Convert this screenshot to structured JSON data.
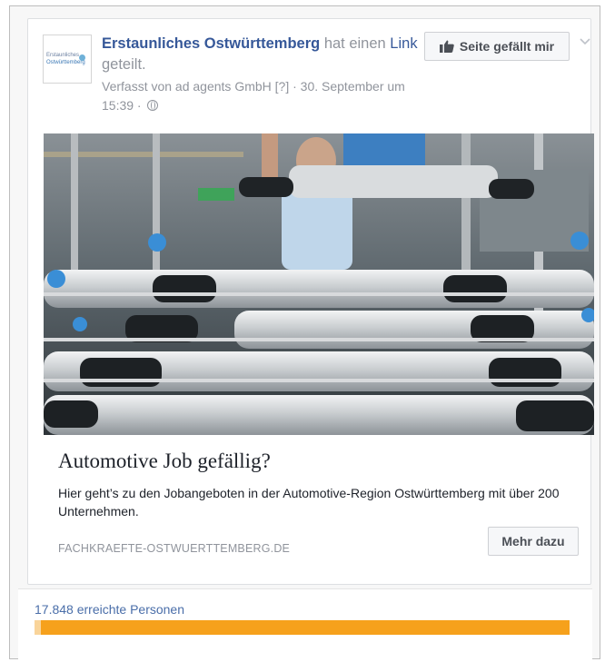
{
  "post": {
    "page_name": "Erstaunliches Ostwürttemberg",
    "action_prefix": " hat einen ",
    "action_link": "Link",
    "action_suffix": " geteilt.",
    "meta": "Verfasst von ad agents GmbH [?] · 30. September um 15:39 ·",
    "privacy_icon": "globe-icon",
    "avatar_text_line1": "Erstaunliches",
    "avatar_text_line2": "Ostwürttemberg"
  },
  "like_button": {
    "label": "Seite gefällt mir",
    "icon": "thumbs-up-icon"
  },
  "menu_icon": "chevron-down-icon",
  "link_preview": {
    "title": "Automotive Job gefällig?",
    "description": "Hier geht’s zu den Jobangeboten in der Automotive-Region Ostwürttemberg mit über 200 Unternehmen.",
    "domain": "FACHKRAEFTE-OSTWUERTTEMBERG.DE",
    "cta_label": "Mehr dazu"
  },
  "reach": {
    "label": "17.848 erreichte Personen",
    "bar_color": "#f6a11c"
  },
  "colors": {
    "link_blue": "#365899",
    "meta_grey": "#90949c",
    "reach_orange": "#f6a11c"
  }
}
